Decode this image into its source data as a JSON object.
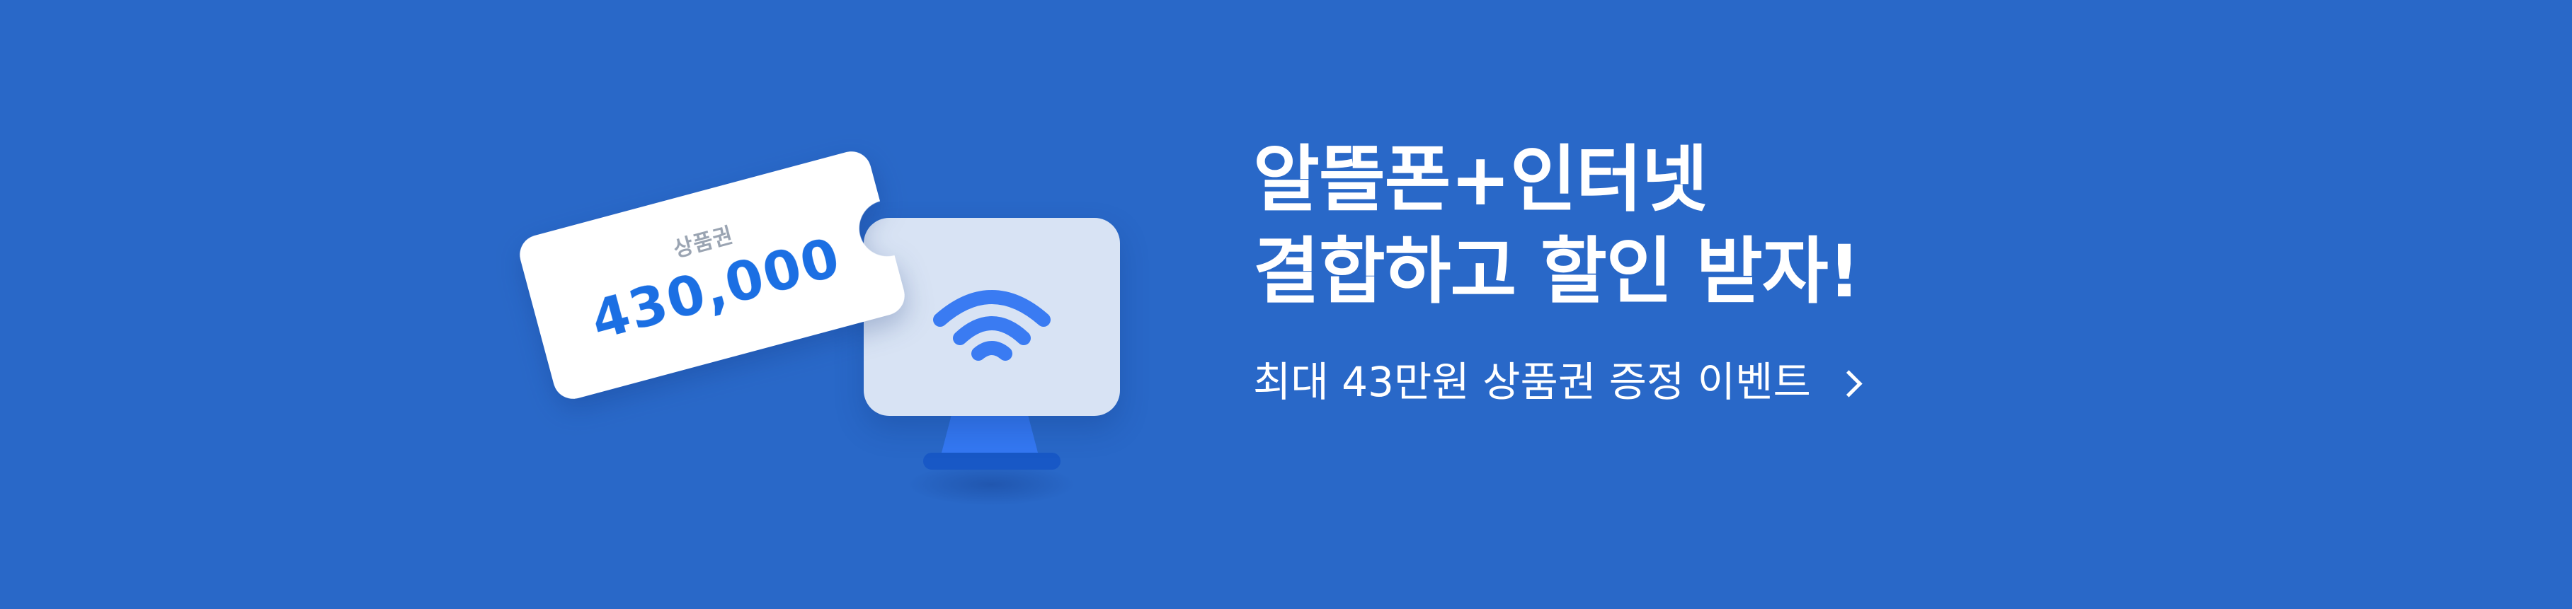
{
  "banner": {
    "background_color": "#2968C8",
    "headline_line_1": "알뜰폰+인터넷",
    "headline_line_2": "결합하고 할인 받자!",
    "cta_text": "최대 43만원 상품권 증정 이벤트",
    "cta_icon": "chevron-right-icon"
  },
  "illustration": {
    "ticket_label": "상품권",
    "ticket_amount": "430,000",
    "ticket_amount_color": "#1B6FE3",
    "monitor_icon": "wifi-icon",
    "accent_color": "#3478F2"
  }
}
